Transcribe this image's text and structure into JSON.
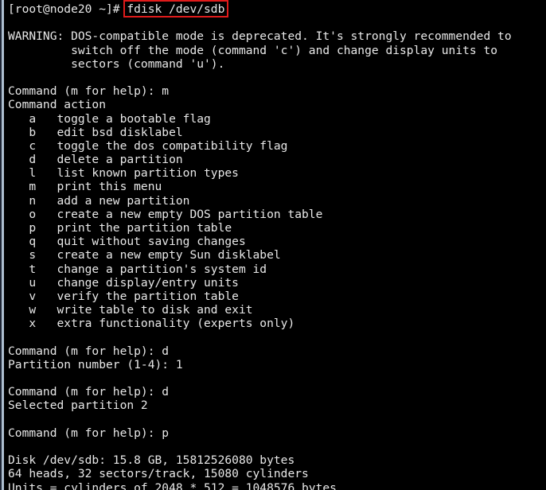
{
  "terminal": {
    "title": "fdisk /dev/sdb",
    "background_color": "#000000",
    "text_color": "#e8e8e8",
    "highlight_color": "#e01b1b",
    "edge_dark_color": "#1d2433",
    "edge_light_color": "#aebfd0",
    "prompt": "[root@node20 ~]# ",
    "typed_command": "fdisk /dev/sdb",
    "lines": [
      {
        "text": "",
        "kind": "blank"
      },
      {
        "text": "WARNING: DOS-compatible mode is deprecated. It's strongly recommended to",
        "kind": "output"
      },
      {
        "text": "         switch off the mode (command 'c') and change display units to",
        "kind": "output"
      },
      {
        "text": "         sectors (command 'u').",
        "kind": "output"
      },
      {
        "text": "",
        "kind": "blank"
      },
      {
        "text": "Command (m for help): m",
        "kind": "prompt"
      },
      {
        "text": "Command action",
        "kind": "output"
      },
      {
        "text": "   a   toggle a bootable flag",
        "kind": "output"
      },
      {
        "text": "   b   edit bsd disklabel",
        "kind": "output"
      },
      {
        "text": "   c   toggle the dos compatibility flag",
        "kind": "output"
      },
      {
        "text": "   d   delete a partition",
        "kind": "output"
      },
      {
        "text": "   l   list known partition types",
        "kind": "output"
      },
      {
        "text": "   m   print this menu",
        "kind": "output"
      },
      {
        "text": "   n   add a new partition",
        "kind": "output"
      },
      {
        "text": "   o   create a new empty DOS partition table",
        "kind": "output"
      },
      {
        "text": "   p   print the partition table",
        "kind": "output"
      },
      {
        "text": "   q   quit without saving changes",
        "kind": "output"
      },
      {
        "text": "   s   create a new empty Sun disklabel",
        "kind": "output"
      },
      {
        "text": "   t   change a partition's system id",
        "kind": "output"
      },
      {
        "text": "   u   change display/entry units",
        "kind": "output"
      },
      {
        "text": "   v   verify the partition table",
        "kind": "output"
      },
      {
        "text": "   w   write table to disk and exit",
        "kind": "output"
      },
      {
        "text": "   x   extra functionality (experts only)",
        "kind": "output"
      },
      {
        "text": "",
        "kind": "blank"
      },
      {
        "text": "Command (m for help): d",
        "kind": "prompt"
      },
      {
        "text": "Partition number (1-4): 1",
        "kind": "prompt"
      },
      {
        "text": "",
        "kind": "blank"
      },
      {
        "text": "Command (m for help): d",
        "kind": "prompt"
      },
      {
        "text": "Selected partition 2",
        "kind": "output"
      },
      {
        "text": "",
        "kind": "blank"
      },
      {
        "text": "Command (m for help): p",
        "kind": "prompt"
      },
      {
        "text": "",
        "kind": "blank"
      },
      {
        "text": "Disk /dev/sdb: 15.8 GB, 15812526080 bytes",
        "kind": "output"
      },
      {
        "text": "64 heads, 32 sectors/track, 15080 cylinders",
        "kind": "output"
      },
      {
        "text": "Units = cylinders of 2048 * 512 = 1048576 bytes",
        "kind": "output"
      }
    ],
    "disk_info": {
      "device": "/dev/sdb",
      "size_human": "15.8 GB",
      "size_bytes": "15812526080",
      "heads": "64",
      "sectors_per_track": "32",
      "cylinders": "15080",
      "unit_cylinder_sectors": "2048",
      "sector_size": "512",
      "unit_bytes": "1048576"
    },
    "menu": [
      {
        "key": "a",
        "description": "toggle a bootable flag"
      },
      {
        "key": "b",
        "description": "edit bsd disklabel"
      },
      {
        "key": "c",
        "description": "toggle the dos compatibility flag"
      },
      {
        "key": "d",
        "description": "delete a partition"
      },
      {
        "key": "l",
        "description": "list known partition types"
      },
      {
        "key": "m",
        "description": "print this menu"
      },
      {
        "key": "n",
        "description": "add a new partition"
      },
      {
        "key": "o",
        "description": "create a new empty DOS partition table"
      },
      {
        "key": "p",
        "description": "print the partition table"
      },
      {
        "key": "q",
        "description": "quit without saving changes"
      },
      {
        "key": "s",
        "description": "create a new empty Sun disklabel"
      },
      {
        "key": "t",
        "description": "change a partition's system id"
      },
      {
        "key": "u",
        "description": "change display/entry units"
      },
      {
        "key": "v",
        "description": "verify the partition table"
      },
      {
        "key": "w",
        "description": "write table to disk and exit"
      },
      {
        "key": "x",
        "description": "extra functionality (experts only)"
      }
    ]
  }
}
